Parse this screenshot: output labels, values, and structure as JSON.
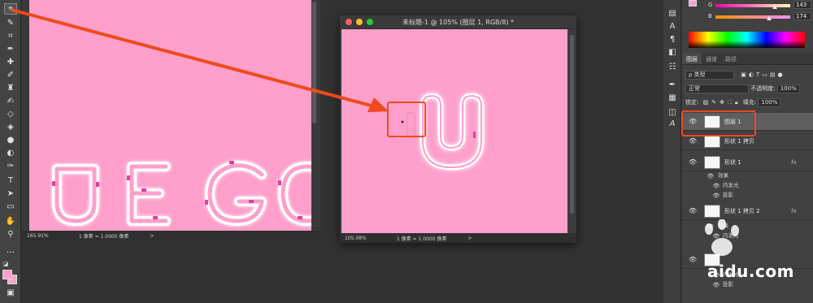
{
  "doc1": {
    "status_zoom": "165.91%",
    "status_info": "1 像素 = 1.0000 像素",
    "status_arrow": ">",
    "art_letters": [
      "U",
      "E",
      "G",
      "O"
    ]
  },
  "doc2": {
    "title": "未标题-1 @ 105% (图层 1, RGB/8) *",
    "status_zoom": "105.08%",
    "status_info": "1 像素 = 1.0000 像素",
    "status_arrow": ">",
    "art_letter": "U"
  },
  "color_panel": {
    "g_label": "G",
    "b_label": "B",
    "b_value": "143",
    "g_value": "174"
  },
  "panel_tabs": [
    "图层",
    "通道",
    "路径"
  ],
  "layer_props": {
    "filter_kind": "ρ 类型",
    "blend_mode": "正常",
    "opacity_label": "不透明度:",
    "opacity_value": "100%",
    "lock_label": "锁定:",
    "fill_label": "填充:",
    "fill_value": "100%"
  },
  "layers": [
    {
      "name": "图层 1",
      "selected": true
    },
    {
      "name": "形状 1 拷贝",
      "selected": false
    },
    {
      "name": "形状 1",
      "selected": false,
      "fx": "fx"
    },
    {
      "name": "形状 1 拷贝 2",
      "selected": false,
      "fx": "fx"
    }
  ],
  "layer_effects": {
    "effects_label": "效果",
    "inner_glow": "内发光",
    "drop_shadow": "投影"
  },
  "watermark": {
    "text": "aidu.com"
  },
  "colors": {
    "canvas_pink": "#ff9fcb",
    "annotation": "#ef4a1b",
    "foreground": "#ff9ecb",
    "background": "#f6a3c8"
  }
}
